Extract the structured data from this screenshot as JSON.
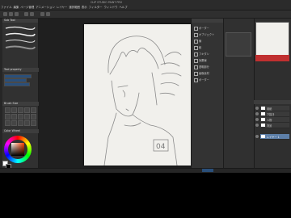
{
  "window": {
    "title": "CLIP STUDIO PAINT PRO"
  },
  "menu": [
    "ファイル",
    "編集",
    "ページ管理",
    "アニメーション",
    "レイヤー",
    "選択範囲",
    "表示",
    "フィルター",
    "ウィンドウ",
    "ヘルプ"
  ],
  "left_panel": {
    "subtool_title": "Sub Tool",
    "tool_property_title": "Tool property",
    "brush_size_title": "Brush Size",
    "color_wheel_title": "Color Wheel"
  },
  "canvas": {
    "sketch_label": "04"
  },
  "mid_panel": {
    "items": [
      "ボーダー",
      "オブジェクト",
      "線",
      "紙",
      "フキダシ",
      "効果線",
      "透明部分",
      "画像素材",
      "ボーダー"
    ]
  },
  "right_panel": {
    "layers": [
      "用紙",
      "下描き",
      "人物",
      "背景",
      "レイヤー 1"
    ]
  },
  "colors": {
    "accent": "#5d7fa8",
    "foreground": "#ffffff",
    "background": "#000000"
  }
}
